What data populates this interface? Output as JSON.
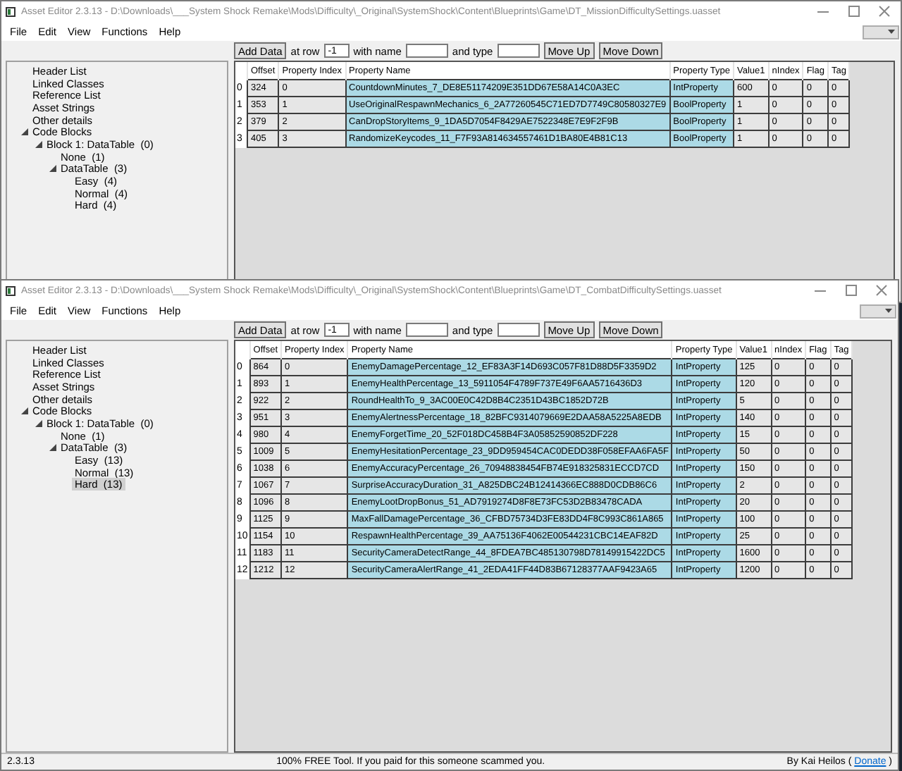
{
  "windows": [
    {
      "title": "Asset Editor 2.3.13 - D:\\Downloads\\___System Shock Remake\\Mods\\Difficulty\\_Original\\SystemShock\\Content\\Blueprints\\Game\\DT_MissionDifficultySettings.uasset",
      "menu": [
        "File",
        "Edit",
        "View",
        "Functions",
        "Help"
      ],
      "toolbar": {
        "add_button": "Add Data",
        "row_label": "at row",
        "row_value": "-1",
        "name_label": "with name",
        "type_label": "and type",
        "up_button": "Move Up",
        "down_button": "Move Down"
      },
      "tree": [
        {
          "label": "Header List",
          "selected": false
        },
        {
          "label": "Linked Classes",
          "selected": false
        },
        {
          "label": "Reference List",
          "selected": false
        },
        {
          "label": "Asset Strings",
          "selected": false
        },
        {
          "label": "Other details",
          "selected": false
        },
        {
          "label": "Code Blocks",
          "expanded": true,
          "selected": false,
          "children": [
            {
              "label": "Block 1: DataTable  (0)",
              "expanded": true,
              "selected": false,
              "children": [
                {
                  "label": "None  (1)",
                  "selected": false
                },
                {
                  "label": "DataTable  (3)",
                  "expanded": true,
                  "selected": false,
                  "children": [
                    {
                      "label": "Easy  (4)",
                      "selected": false
                    },
                    {
                      "label": "Normal  (4)",
                      "selected": false
                    },
                    {
                      "label": "Hard  (4)",
                      "selected": false
                    }
                  ]
                }
              ]
            }
          ]
        }
      ],
      "table": {
        "columns": [
          {
            "label": "Offset",
            "highlighted": false
          },
          {
            "label": "Property Index",
            "highlighted": false
          },
          {
            "label": "Property Name",
            "highlighted": true
          },
          {
            "label": "Property Type",
            "highlighted": true
          },
          {
            "label": "Value1",
            "highlighted": false
          },
          {
            "label": "nIndex",
            "highlighted": false
          },
          {
            "label": "Flag",
            "highlighted": false
          },
          {
            "label": "Tag",
            "highlighted": false
          }
        ],
        "rows": [
          {
            "index": "0",
            "cells": [
              "324",
              "0",
              "CountdownMinutes_7_DE8E51174209E351DD67E58A14C0A3EC",
              "IntProperty",
              "600",
              "0",
              "0",
              "0"
            ]
          },
          {
            "index": "1",
            "cells": [
              "353",
              "1",
              "UseOriginalRespawnMechanics_6_2A77260545C71ED7D7749C80580327E9",
              "BoolProperty",
              "1",
              "0",
              "0",
              "0"
            ]
          },
          {
            "index": "2",
            "cells": [
              "379",
              "2",
              "CanDropStoryItems_9_1DA5D7054F8429AE7522348E7E9F2F9B",
              "BoolProperty",
              "1",
              "0",
              "0",
              "0"
            ]
          },
          {
            "index": "3",
            "cells": [
              "405",
              "3",
              "RandomizeKeycodes_11_F7F93A814634557461D1BA80E4B81C13",
              "BoolProperty",
              "1",
              "0",
              "0",
              "0"
            ]
          }
        ]
      }
    },
    {
      "title": "Asset Editor 2.3.13 - D:\\Downloads\\___System Shock Remake\\Mods\\Difficulty\\_Original\\SystemShock\\Content\\Blueprints\\Game\\DT_CombatDifficultySettings.uasset",
      "menu": [
        "File",
        "Edit",
        "View",
        "Functions",
        "Help"
      ],
      "toolbar": {
        "add_button": "Add Data",
        "row_label": "at row",
        "row_value": "-1",
        "name_label": "with name",
        "type_label": "and type",
        "up_button": "Move Up",
        "down_button": "Move Down"
      },
      "tree": [
        {
          "label": "Header List",
          "selected": false
        },
        {
          "label": "Linked Classes",
          "selected": false
        },
        {
          "label": "Reference List",
          "selected": false
        },
        {
          "label": "Asset Strings",
          "selected": false
        },
        {
          "label": "Other details",
          "selected": false
        },
        {
          "label": "Code Blocks",
          "expanded": true,
          "selected": false,
          "children": [
            {
              "label": "Block 1: DataTable  (0)",
              "expanded": true,
              "selected": false,
              "children": [
                {
                  "label": "None  (1)",
                  "selected": false
                },
                {
                  "label": "DataTable  (3)",
                  "expanded": true,
                  "selected": false,
                  "children": [
                    {
                      "label": "Easy  (13)",
                      "selected": false
                    },
                    {
                      "label": "Normal  (13)",
                      "selected": false
                    },
                    {
                      "label": "Hard  (13)",
                      "selected": true
                    }
                  ]
                }
              ]
            }
          ]
        }
      ],
      "table": {
        "columns": [
          {
            "label": "Offset",
            "highlighted": false
          },
          {
            "label": "Property Index",
            "highlighted": false
          },
          {
            "label": "Property Name",
            "highlighted": true
          },
          {
            "label": "Property Type",
            "highlighted": true
          },
          {
            "label": "Value1",
            "highlighted": false
          },
          {
            "label": "nIndex",
            "highlighted": false
          },
          {
            "label": "Flag",
            "highlighted": false
          },
          {
            "label": "Tag",
            "highlighted": false
          }
        ],
        "rows": [
          {
            "index": "0",
            "cells": [
              "864",
              "0",
              "EnemyDamagePercentage_12_EF83A3F14D693C057F81D88D5F3359D2",
              "IntProperty",
              "125",
              "0",
              "0",
              "0"
            ]
          },
          {
            "index": "1",
            "cells": [
              "893",
              "1",
              "EnemyHealthPercentage_13_5911054F4789F737E49F6AA5716436D3",
              "IntProperty",
              "120",
              "0",
              "0",
              "0"
            ]
          },
          {
            "index": "2",
            "cells": [
              "922",
              "2",
              "RoundHealthTo_9_3AC00E0C42D8B4C2351D43BC1852D72B",
              "IntProperty",
              "5",
              "0",
              "0",
              "0"
            ]
          },
          {
            "index": "3",
            "cells": [
              "951",
              "3",
              "EnemyAlertnessPercentage_18_82BFC9314079669E2DAA58A5225A8EDB",
              "IntProperty",
              "140",
              "0",
              "0",
              "0"
            ]
          },
          {
            "index": "4",
            "cells": [
              "980",
              "4",
              "EnemyForgetTime_20_52F018DC458B4F3A05852590852DF228",
              "IntProperty",
              "15",
              "0",
              "0",
              "0"
            ]
          },
          {
            "index": "5",
            "cells": [
              "1009",
              "5",
              "EnemyHesitationPercentage_23_9DD959454CAC0DEDD38F058EFAA6FA5F",
              "IntProperty",
              "50",
              "0",
              "0",
              "0"
            ]
          },
          {
            "index": "6",
            "cells": [
              "1038",
              "6",
              "EnemyAccuracyPercentage_26_70948838454FB74E918325831ECCD7CD",
              "IntProperty",
              "150",
              "0",
              "0",
              "0"
            ]
          },
          {
            "index": "7",
            "cells": [
              "1067",
              "7",
              "SurpriseAccuracyDuration_31_A825DBC24B12414366EC888D0CDB86C6",
              "IntProperty",
              "2",
              "0",
              "0",
              "0"
            ]
          },
          {
            "index": "8",
            "cells": [
              "1096",
              "8",
              "EnemyLootDropBonus_51_AD7919274D8F8E73FC53D2B83478CADA",
              "IntProperty",
              "20",
              "0",
              "0",
              "0"
            ]
          },
          {
            "index": "9",
            "cells": [
              "1125",
              "9",
              "MaxFallDamagePercentage_36_CFBD75734D3FE83DD4F8C993C861A865",
              "IntProperty",
              "100",
              "0",
              "0",
              "0"
            ]
          },
          {
            "index": "10",
            "cells": [
              "1154",
              "10",
              "RespawnHealthPercentage_39_AA75136F4062E00544231CBC14EAF82D",
              "IntProperty",
              "25",
              "0",
              "0",
              "0"
            ]
          },
          {
            "index": "11",
            "cells": [
              "1183",
              "11",
              "SecurityCameraDetectRange_44_8FDEA7BC485130798D78149915422DC5",
              "IntProperty",
              "1600",
              "0",
              "0",
              "0"
            ]
          },
          {
            "index": "12",
            "cells": [
              "1212",
              "12",
              "SecurityCameraAlertRange_41_2EDA41FF44D83B67128377AAF9423A65",
              "IntProperty",
              "1200",
              "0",
              "0",
              "0"
            ]
          }
        ]
      },
      "status_bar": {
        "version": "2.3.13",
        "message": "100% FREE Tool. If you paid for this someone scammed you.",
        "credit": "By Kai Heilos (",
        "link": "Donate",
        "credit_end": ")"
      }
    }
  ]
}
